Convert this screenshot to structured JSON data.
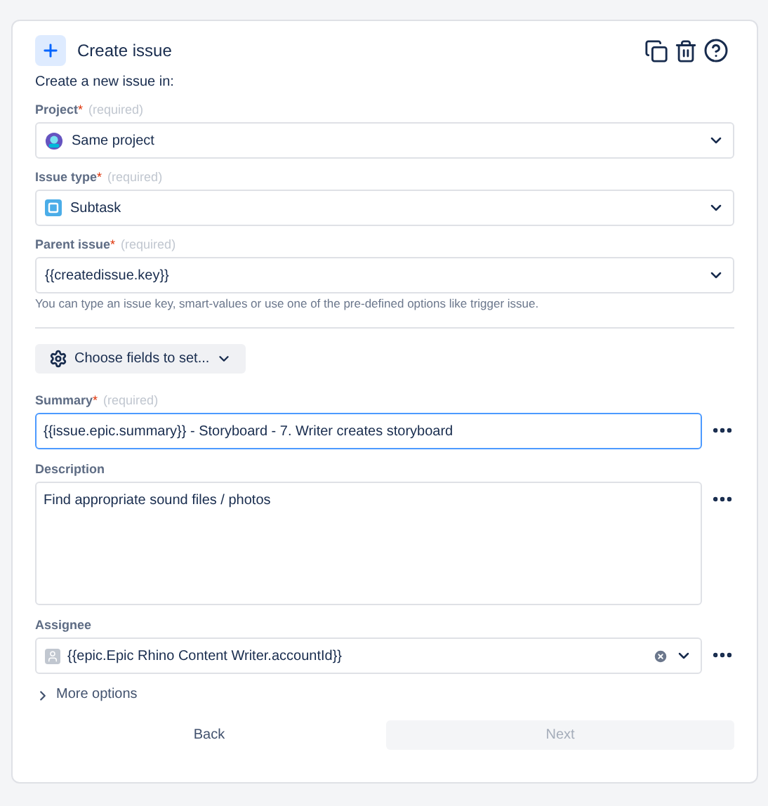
{
  "header": {
    "title": "Create issue"
  },
  "intro": "Create a new issue in:",
  "location_fields": [
    {
      "label": "Project",
      "required_mark": "*",
      "required_hint": "(required)",
      "value": "Same project",
      "kind": "project"
    },
    {
      "label": "Issue type",
      "required_mark": "*",
      "required_hint": "(required)",
      "value": "Subtask",
      "kind": "subtask"
    },
    {
      "label": "Parent issue",
      "required_mark": "*",
      "required_hint": "(required)",
      "value": "{{createdissue.key}}",
      "kind": "plain"
    }
  ],
  "parent_hint": "You can type an issue key, smart-values or use one of the pre-defined options like trigger issue.",
  "choose_fields_button": "Choose fields to set...",
  "fields": [
    {
      "kind": "text",
      "label": "Summary",
      "required_mark": "*",
      "required_hint": "(required)",
      "value": "{{issue.epic.summary}} - Storyboard - 7. Writer creates storyboard",
      "focused": true
    },
    {
      "kind": "textarea",
      "label": "Description",
      "value": "Find appropriate sound files / photos",
      "focused": false
    },
    {
      "kind": "user",
      "label": "Assignee",
      "value": "{{epic.Epic Rhino Content Writer.accountId}}",
      "focused": false
    }
  ],
  "more_options": {
    "label": "More options",
    "expanded": false
  },
  "buttons": [
    {
      "label": "Back",
      "disabled": false
    },
    {
      "label": "Next",
      "disabled": true
    }
  ]
}
